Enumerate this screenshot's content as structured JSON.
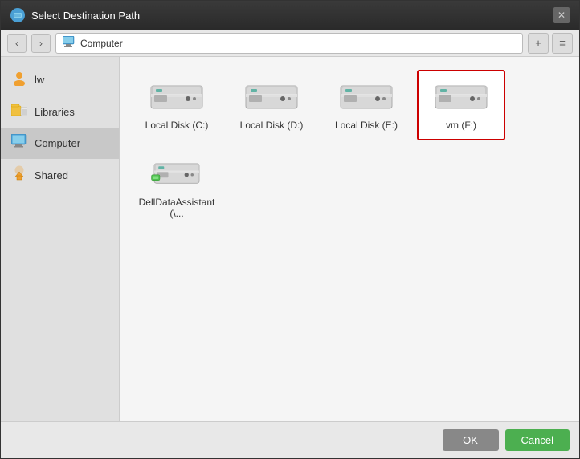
{
  "dialog": {
    "title": "Select Destination Path",
    "title_icon_label": "SW"
  },
  "toolbar": {
    "back_label": "‹",
    "forward_label": "›",
    "location": "Computer",
    "add_label": "+",
    "view_label": "≡"
  },
  "sidebar": {
    "items": [
      {
        "id": "lw",
        "label": "lw",
        "icon": "👤"
      },
      {
        "id": "libraries",
        "label": "Libraries",
        "icon": "📁"
      },
      {
        "id": "computer",
        "label": "Computer",
        "icon": "🖥"
      },
      {
        "id": "shared",
        "label": "Shared",
        "icon": "⬇"
      }
    ]
  },
  "drives": [
    {
      "id": "c",
      "label": "Local Disk (C:)",
      "type": "hdd",
      "selected": false
    },
    {
      "id": "d",
      "label": "Local Disk (D:)",
      "type": "hdd",
      "selected": false
    },
    {
      "id": "e",
      "label": "Local Disk (E:)",
      "type": "hdd",
      "selected": false
    },
    {
      "id": "f",
      "label": "vm (F:)",
      "type": "hdd",
      "selected": true
    },
    {
      "id": "net",
      "label": "DellDataAssistant (\\...",
      "type": "network",
      "selected": false
    }
  ],
  "footer": {
    "ok_label": "OK",
    "cancel_label": "Cancel"
  }
}
